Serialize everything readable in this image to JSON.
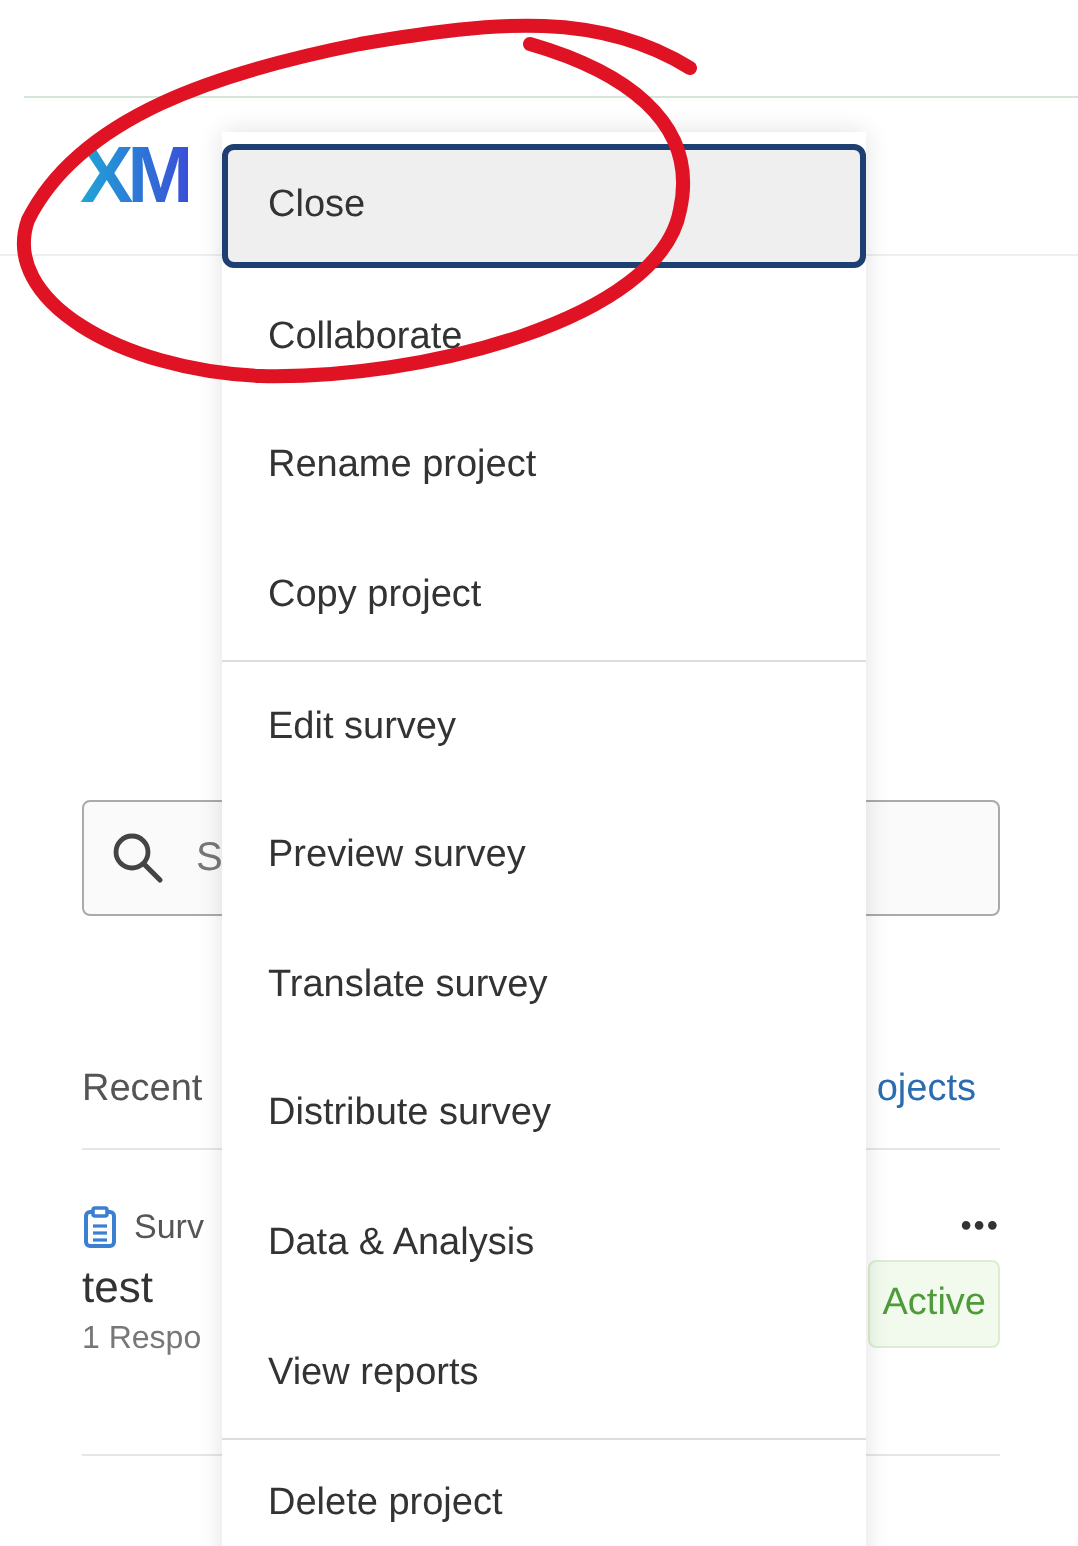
{
  "logo": {
    "text": "XM"
  },
  "search": {
    "placeholder": "S"
  },
  "recent": {
    "heading": "Recent",
    "link": "ojects"
  },
  "project": {
    "type": "Surv",
    "name": "test",
    "meta": "1 Respo",
    "status": "Active",
    "more": "•••"
  },
  "menu": {
    "groups": [
      [
        {
          "label": "Close",
          "selected": true
        },
        {
          "label": "Collaborate",
          "selected": false
        },
        {
          "label": "Rename project",
          "selected": false
        },
        {
          "label": "Copy project",
          "selected": false
        }
      ],
      [
        {
          "label": "Edit survey",
          "selected": false
        },
        {
          "label": "Preview survey",
          "selected": false
        },
        {
          "label": "Translate survey",
          "selected": false
        },
        {
          "label": "Distribute survey",
          "selected": false
        },
        {
          "label": "Data & Analysis",
          "selected": false
        },
        {
          "label": "View reports",
          "selected": false
        }
      ],
      [
        {
          "label": "Delete project",
          "selected": false
        }
      ]
    ]
  }
}
